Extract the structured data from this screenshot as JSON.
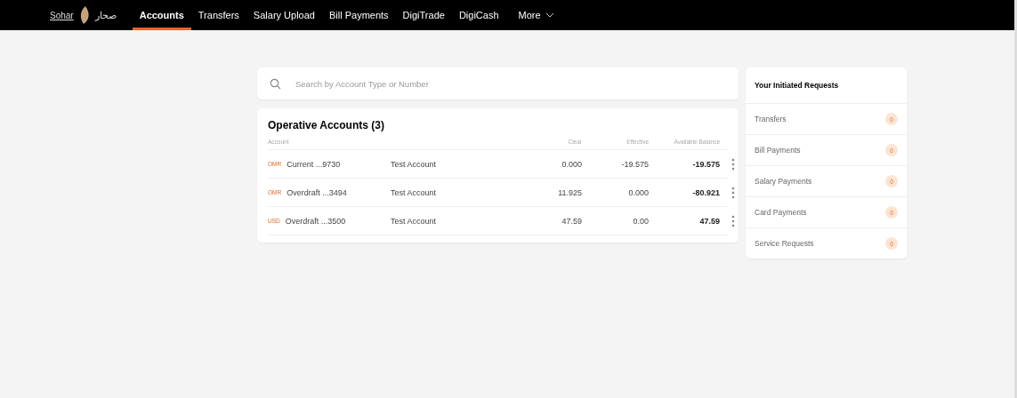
{
  "nav": {
    "logo_text": "Sohar",
    "logo_arabic": "صحار",
    "tabs": [
      {
        "label": "Accounts",
        "selected": true
      },
      {
        "label": "Transfers",
        "selected": false
      },
      {
        "label": "Salary Upload",
        "selected": false
      },
      {
        "label": "Bill Payments",
        "selected": false
      },
      {
        "label": "DigiTrade",
        "selected": false
      },
      {
        "label": "DigiCash",
        "selected": false
      }
    ],
    "more": "More"
  },
  "search": {
    "placeholder": "Search by Account Type or Number"
  },
  "accounts": {
    "title": "Operative Accounts (3)",
    "columns": [
      "Account",
      "Clear",
      "Effective",
      "Available Balance"
    ],
    "rows": [
      {
        "currency": "OMR",
        "account": "Current ...9730",
        "name": "Test Account",
        "clear": "0.000",
        "effective": "-19.575",
        "available": "-19.575"
      },
      {
        "currency": "OMR",
        "account": "Overdraft ...3494",
        "name": "Test Account",
        "clear": "11.925",
        "effective": "0.000",
        "available": "-80.921"
      },
      {
        "currency": "USD",
        "account": "Overdraft ...3500",
        "name": "Test Account",
        "clear": "47.59",
        "effective": "0.00",
        "available": "47.59"
      }
    ]
  },
  "requests": {
    "title": "Your Initiated Requests",
    "items": [
      {
        "label": "Transfers",
        "count": "0"
      },
      {
        "label": "Bill Payments",
        "count": "0"
      },
      {
        "label": "Salary Payments",
        "count": "0"
      },
      {
        "label": "Card Payments",
        "count": "0"
      },
      {
        "label": "Service Requests",
        "count": "0"
      }
    ]
  }
}
